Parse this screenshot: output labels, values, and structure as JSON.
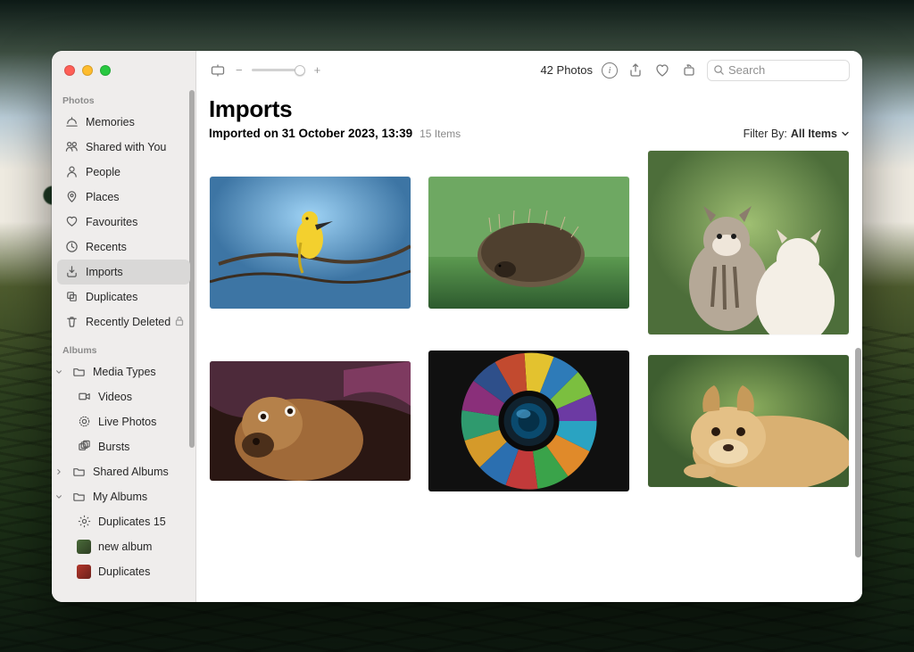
{
  "sidebar": {
    "photos_header": "Photos",
    "albums_header": "Albums",
    "items": [
      {
        "label": "Memories",
        "icon": "memories"
      },
      {
        "label": "Shared with You",
        "icon": "shared"
      },
      {
        "label": "People",
        "icon": "people"
      },
      {
        "label": "Places",
        "icon": "places"
      },
      {
        "label": "Favourites",
        "icon": "heart"
      },
      {
        "label": "Recents",
        "icon": "clock"
      },
      {
        "label": "Imports",
        "icon": "import",
        "selected": true
      },
      {
        "label": "Duplicates",
        "icon": "dup"
      },
      {
        "label": "Recently Deleted",
        "icon": "trash",
        "locked": true
      }
    ],
    "albums": {
      "media_types": {
        "label": "Media Types",
        "open": true,
        "children": [
          {
            "label": "Videos",
            "icon": "video"
          },
          {
            "label": "Live Photos",
            "icon": "live"
          },
          {
            "label": "Bursts",
            "icon": "burst"
          }
        ]
      },
      "shared": {
        "label": "Shared Albums"
      },
      "my_albums": {
        "label": "My Albums",
        "open": true,
        "children": [
          {
            "label": "Duplicates 15",
            "icon": "gear"
          },
          {
            "label": "new album",
            "icon": "thumb-green"
          },
          {
            "label": "Duplicates",
            "icon": "thumb-red"
          }
        ]
      }
    }
  },
  "toolbar": {
    "photo_count": "42 Photos",
    "zoom_minus": "−",
    "zoom_plus": "+",
    "search_placeholder": "Search"
  },
  "page": {
    "title": "Imports",
    "subtitle": "Imported on 31 October 2023, 13:39",
    "item_count": "15 Items",
    "filter_label": "Filter By:",
    "filter_value": "All Items"
  },
  "photos": [
    {
      "name": "yellow-bird"
    },
    {
      "name": "hedgehog"
    },
    {
      "name": "kittens"
    },
    {
      "name": "brown-dog"
    },
    {
      "name": "camera-lens-art"
    },
    {
      "name": "golden-retriever-puppy"
    }
  ]
}
